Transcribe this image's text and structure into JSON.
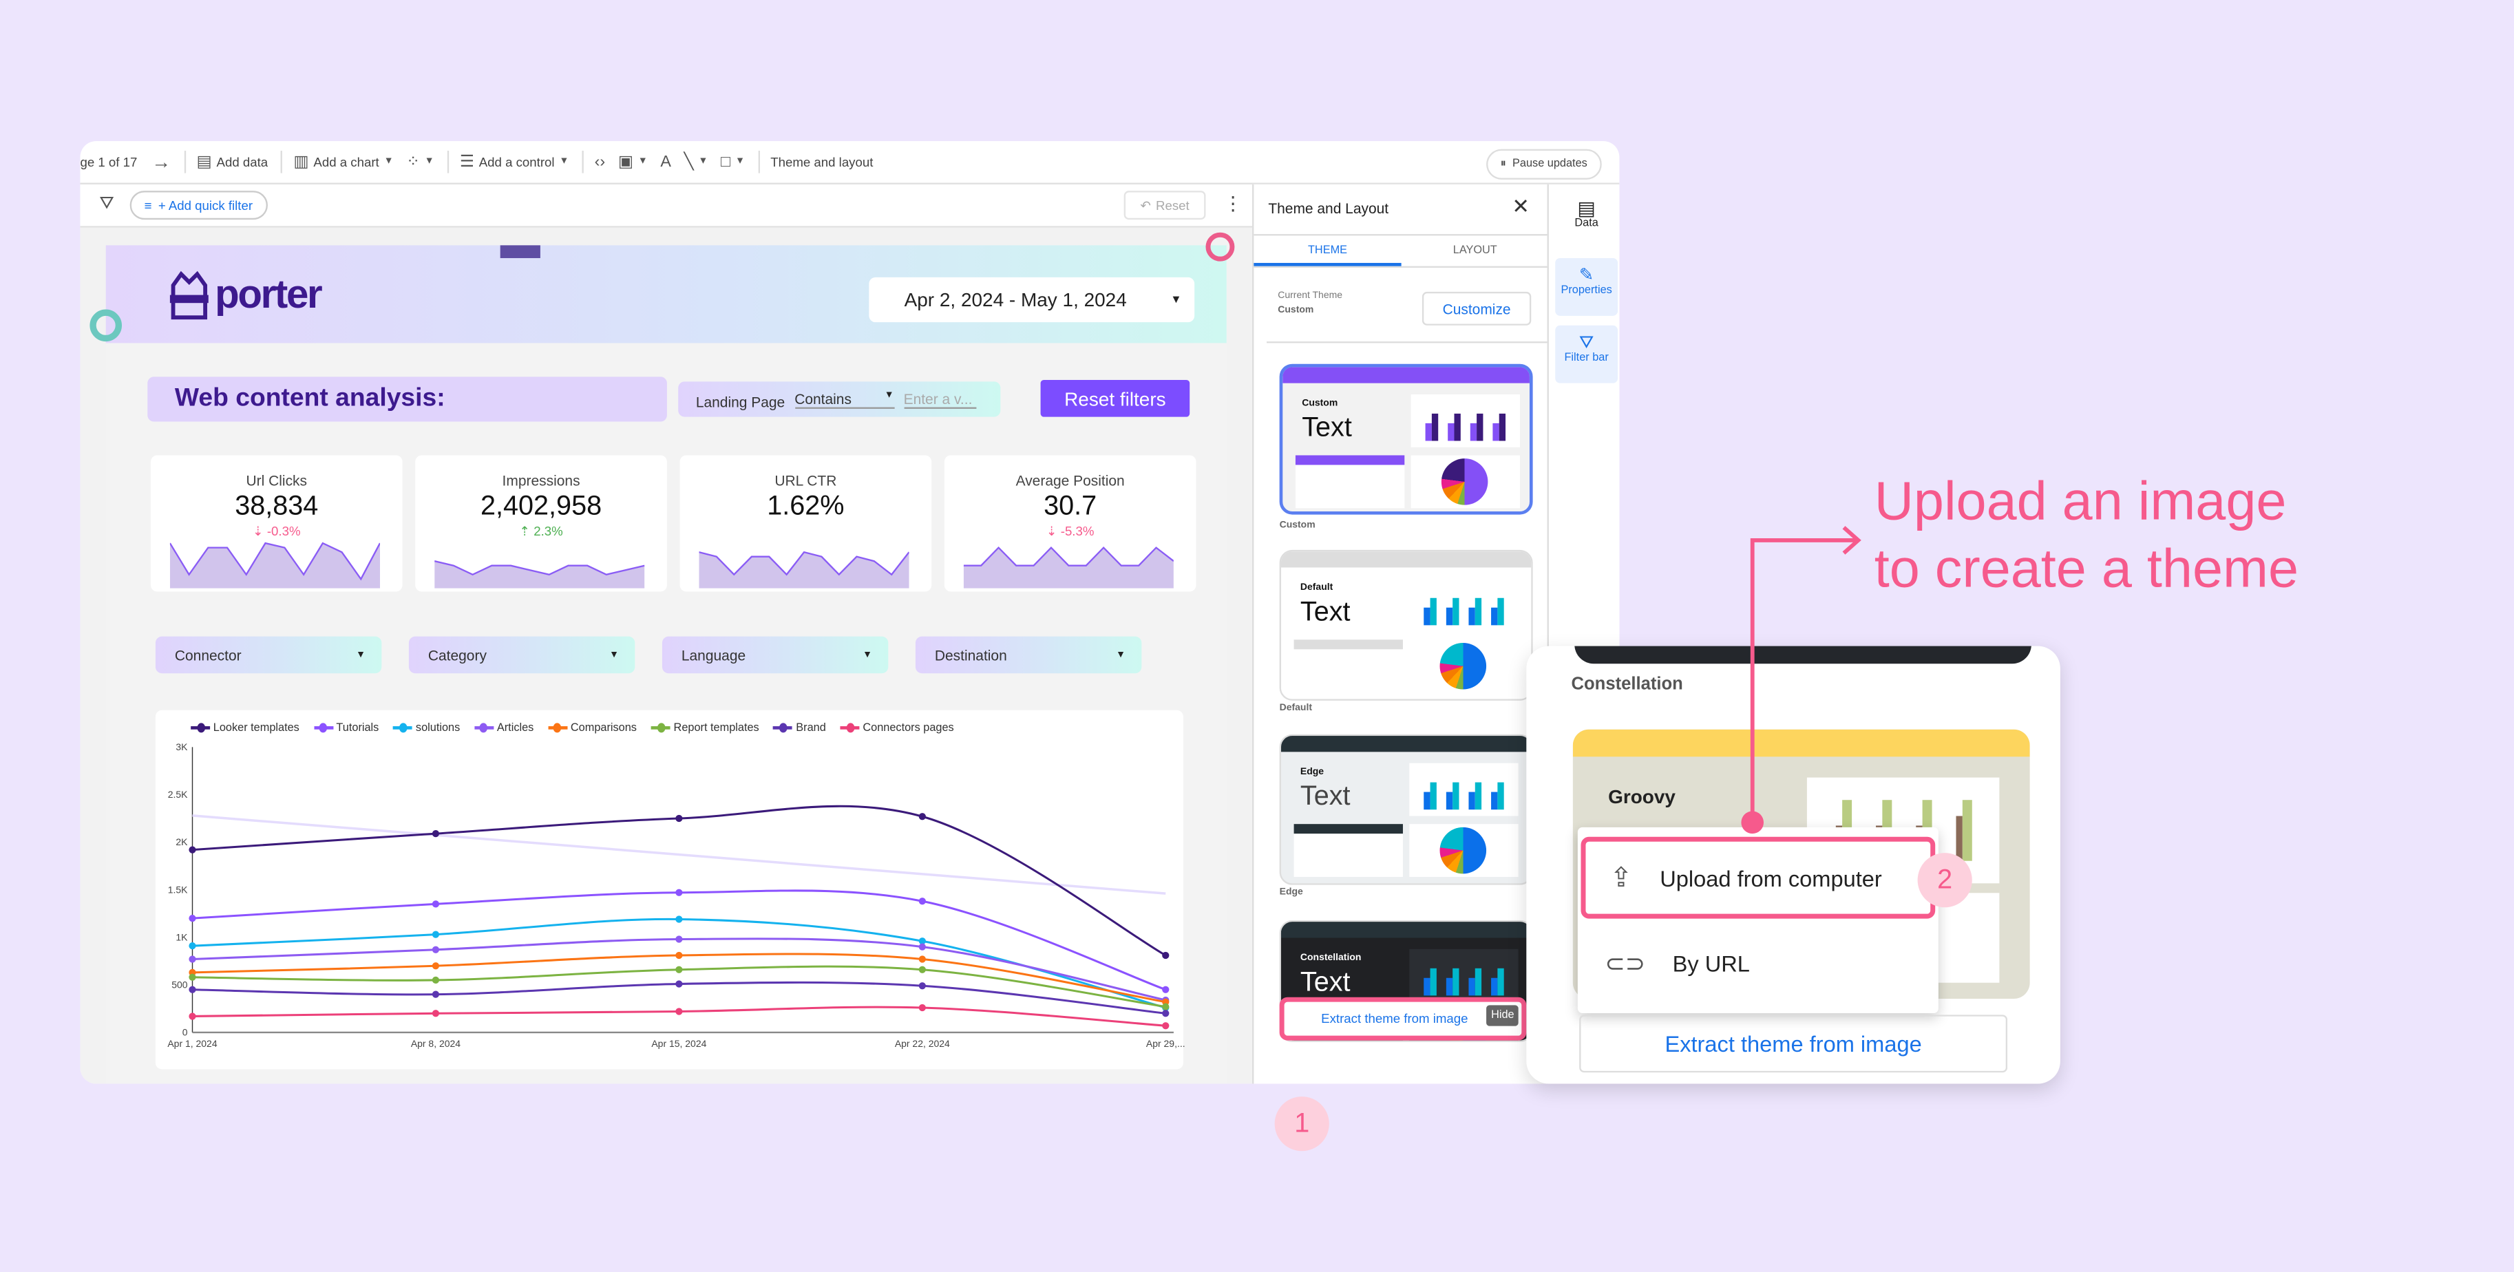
{
  "toolbar": {
    "page_indicator": "ge 1 of 17",
    "add_data": "Add data",
    "add_chart": "Add a chart",
    "add_control": "Add a control",
    "theme_layout": "Theme and layout",
    "pause_updates": "Pause updates"
  },
  "filter_bar": {
    "add_quick_filter": "+ Add quick filter",
    "reset": "Reset"
  },
  "report": {
    "logo_text": "porter",
    "date_range": "Apr 2, 2024 - May 1, 2024",
    "section_title": "Web content analysis:",
    "landing_filter": {
      "label": "Landing Page",
      "operator": "Contains",
      "placeholder": "Enter a v..."
    },
    "reset_filters": "Reset filters",
    "kpis": [
      {
        "label": "Url Clicks",
        "value": "38,834",
        "delta": "-0.3%",
        "direction": "down",
        "spark": [
          9,
          2,
          8,
          8,
          2,
          9,
          8,
          2,
          9,
          7,
          1,
          9
        ]
      },
      {
        "label": "Impressions",
        "value": "2,402,958",
        "delta": "2.3%",
        "direction": "up",
        "spark": [
          5,
          4,
          2,
          4,
          4,
          3,
          2,
          4,
          4,
          2,
          3,
          4
        ]
      },
      {
        "label": "URL CTR",
        "value": "1.62%",
        "delta": "",
        "direction": "none",
        "spark": [
          7,
          6,
          2,
          6,
          6,
          2,
          7,
          6,
          2,
          6,
          5,
          2,
          7
        ]
      },
      {
        "label": "Average Position",
        "value": "30.7",
        "delta": "-5.3%",
        "direction": "down",
        "spark": [
          4,
          4,
          8,
          4,
          4,
          8,
          4,
          4,
          8,
          4,
          4,
          8,
          5
        ]
      }
    ],
    "dropdowns": [
      "Connector",
      "Category",
      "Language",
      "Destination"
    ]
  },
  "chart_data": {
    "type": "line",
    "x": [
      "Apr 1, 2024",
      "Apr 8, 2024",
      "Apr 15, 2024",
      "Apr 22, 2024",
      "Apr 29,..."
    ],
    "y_ticks": [
      "0",
      "500",
      "1K",
      "1.5K",
      "2K",
      "2.5K",
      "3K"
    ],
    "ylim": [
      0,
      3000
    ],
    "legend_position": "top",
    "series": [
      {
        "name": "Looker templates",
        "color": "#3b1a7a",
        "values": [
          1920,
          2090,
          2250,
          2270,
          810
        ]
      },
      {
        "name": "Tutorials",
        "color": "#8b52ff",
        "values": [
          1200,
          1350,
          1470,
          1380,
          450
        ]
      },
      {
        "name": "solutions",
        "color": "#14b2ee",
        "values": [
          910,
          1030,
          1190,
          960,
          260
        ]
      },
      {
        "name": "Articles",
        "color": "#8d5bf2",
        "values": [
          770,
          870,
          980,
          900,
          340
        ]
      },
      {
        "name": "Comparisons",
        "color": "#fb7414",
        "values": [
          630,
          700,
          810,
          770,
          320
        ]
      },
      {
        "name": "Report templates",
        "color": "#7cb342",
        "values": [
          580,
          550,
          660,
          660,
          270
        ]
      },
      {
        "name": "Brand",
        "color": "#5b36b0",
        "values": [
          450,
          400,
          510,
          490,
          200
        ]
      },
      {
        "name": "Connectors pages",
        "color": "#ec4079",
        "values": [
          170,
          200,
          220,
          260,
          70
        ]
      }
    ],
    "trendline": {
      "color": "#e4dcfd",
      "values": [
        2280,
        1460
      ]
    }
  },
  "panel": {
    "title": "Theme and Layout",
    "tabs": [
      "THEME",
      "LAYOUT"
    ],
    "current_theme_label": "Current Theme",
    "current_theme": "Custom",
    "customize": "Customize",
    "themes": [
      {
        "name": "Custom",
        "sample": "Text",
        "bar": "#8450f6",
        "c1": "#8450f6",
        "c2": "#3b1a7a"
      },
      {
        "name": "Default",
        "sample": "Text",
        "bar": "#dddddd",
        "c1": "#0b70ea",
        "c2": "#00b8cc"
      },
      {
        "name": "Edge",
        "sample": "Text",
        "bar": "#263238",
        "c1": "#0b70ea",
        "c2": "#00b8cc"
      },
      {
        "name": "Constellation",
        "sample": "Text",
        "bar": "#263238",
        "c1": "#0b70ea",
        "c2": "#00b8cc"
      }
    ],
    "extract": "Extract theme from image",
    "hide": "Hide"
  },
  "rail": {
    "data": "Data",
    "properties": "Properties",
    "filter_bar": "Filter bar"
  },
  "popup": {
    "theme_name": "Constellation",
    "preview_name": "Groovy",
    "menu": [
      "Upload from computer",
      "By URL"
    ],
    "extract": "Extract theme from image"
  },
  "callout": {
    "line1": "Upload an image",
    "line2": "to create a theme",
    "step1": "1",
    "step2": "2",
    "accent": "#f65a8c"
  }
}
